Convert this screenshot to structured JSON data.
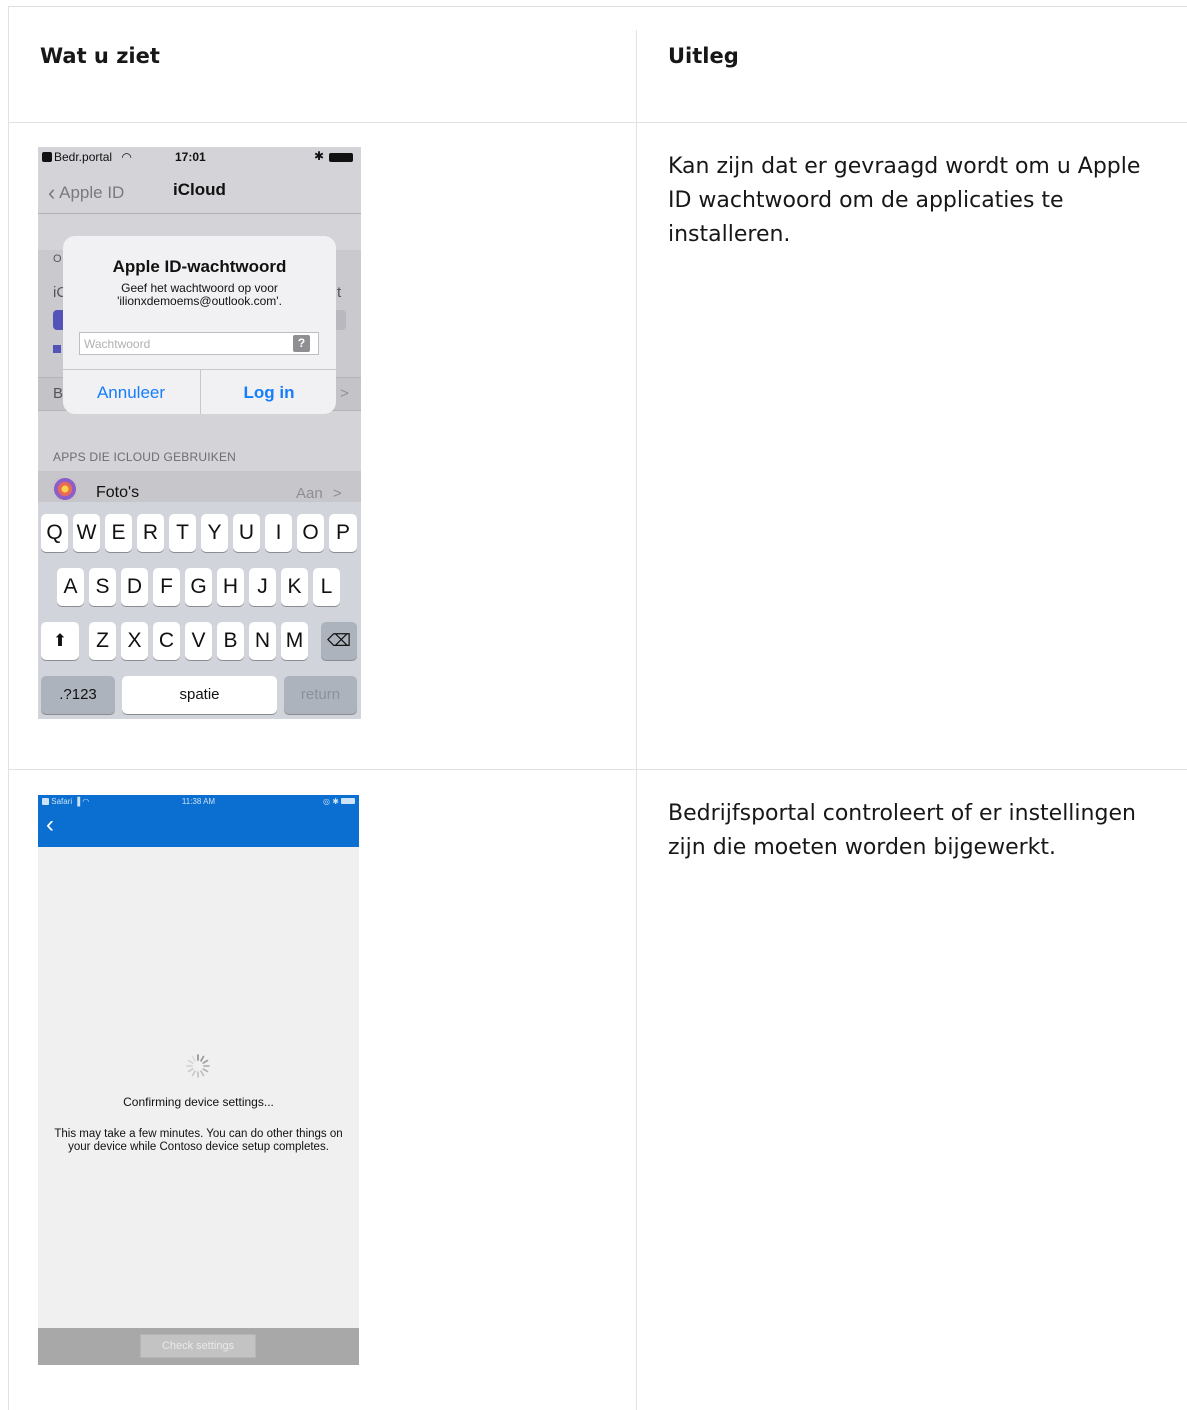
{
  "table": {
    "header_left": "Wat u ziet",
    "header_right": "Uitleg"
  },
  "row1": {
    "description": "Kan zijn dat er gevraagd wordt om u Apple ID wachtwoord om de applicaties te installeren.",
    "phone": {
      "status": {
        "carrier": "Bedr.portal",
        "time": "17:01"
      },
      "nav": {
        "back_label": "Apple ID",
        "title": "iCloud"
      },
      "dialog": {
        "title": "Apple ID-wachtwoord",
        "message": "Geef het wachtwoord op voor\n'ilionxdemoems@outlook.com'.",
        "input_placeholder": "Wachtwoord",
        "input_value": "",
        "help_label": "?",
        "cancel_label": "Annuleer",
        "ok_label": "Log in"
      },
      "background": {
        "section_header": "APPS DIE ICLOUD GEBRUIKEN",
        "photos_label": "Foto's",
        "photos_value": "Aan",
        "chevron": ">",
        "row_fragments": [
          "O",
          "iC",
          "B",
          "t"
        ]
      },
      "keyboard": {
        "row1": [
          "Q",
          "W",
          "E",
          "R",
          "T",
          "Y",
          "U",
          "I",
          "O",
          "P"
        ],
        "row2": [
          "A",
          "S",
          "D",
          "F",
          "G",
          "H",
          "J",
          "K",
          "L"
        ],
        "row3": [
          "Z",
          "X",
          "C",
          "V",
          "B",
          "N",
          "M"
        ],
        "shift": "⬆",
        "delete": "⌫",
        "numbers": ".?123",
        "space": "spatie",
        "return": "return"
      }
    }
  },
  "row2": {
    "description": "Bedrijfsportal controleert of er instellingen zijn die moeten worden bijgewerkt.",
    "phone": {
      "status": {
        "carrier": "Safari",
        "time": "11:38 AM"
      },
      "back_glyph": "‹",
      "confirming": "Confirming device settings...",
      "detail": "This may take a few minutes.  You can do other things on your device while Contoso device setup completes.",
      "check_button": "Check settings"
    }
  }
}
